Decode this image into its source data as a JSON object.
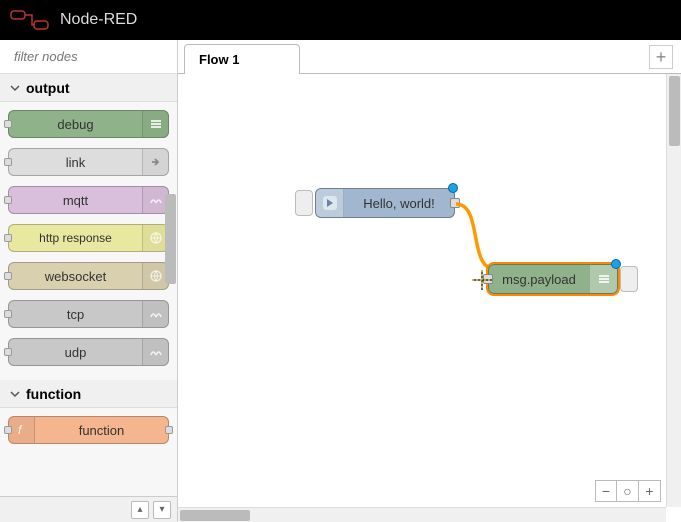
{
  "header": {
    "title": "Node-RED"
  },
  "sidebar": {
    "search_placeholder": "filter nodes",
    "categories": [
      {
        "name": "output",
        "items": [
          {
            "label": "debug",
            "bg": "#8fb28a",
            "icon": "debug"
          },
          {
            "label": "link",
            "bg": "#dddddd",
            "icon": "link"
          },
          {
            "label": "mqtt",
            "bg": "#d9bfdb",
            "icon": "bridge"
          },
          {
            "label": "http response",
            "bg": "#e8e8a0",
            "icon": "globe"
          },
          {
            "label": "websocket",
            "bg": "#d9d0b0",
            "icon": "globe"
          },
          {
            "label": "tcp",
            "bg": "#c8c8c8",
            "icon": "bridge"
          },
          {
            "label": "udp",
            "bg": "#c8c8c8",
            "icon": "bridge"
          }
        ]
      },
      {
        "name": "function",
        "items": [
          {
            "label": "function",
            "bg": "#f4b58f",
            "icon": "function"
          }
        ]
      }
    ]
  },
  "workspace": {
    "tab_label": "Flow 1",
    "nodes": {
      "inject": {
        "label": "Hello, world!",
        "bg": "#a0b7cf"
      },
      "debug": {
        "label": "msg.payload",
        "bg": "#8fb28a"
      }
    }
  }
}
